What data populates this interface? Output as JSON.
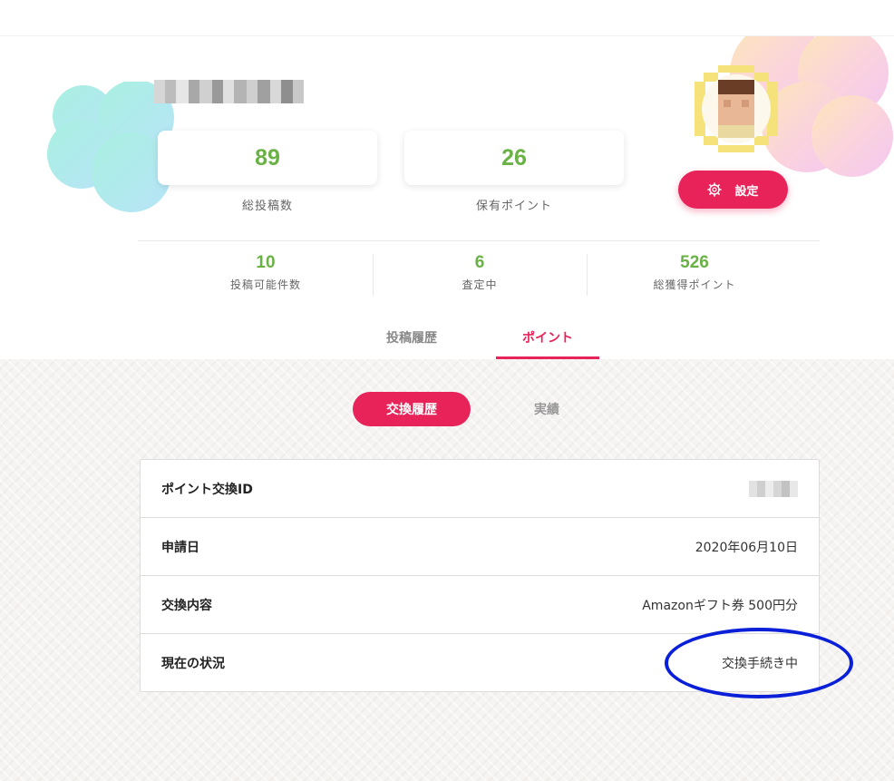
{
  "profile": {
    "stats": [
      {
        "value": "89",
        "label": "総投稿数"
      },
      {
        "value": "26",
        "label": "保有ポイント"
      }
    ],
    "mini_stats": [
      {
        "value": "10",
        "label": "投稿可能件数"
      },
      {
        "value": "6",
        "label": "査定中"
      },
      {
        "value": "526",
        "label": "総獲得ポイント"
      }
    ],
    "settings_label": "設定"
  },
  "tabs": [
    {
      "label": "投稿履歴",
      "active": false
    },
    {
      "label": "ポイント",
      "active": true
    }
  ],
  "sub_tabs": [
    {
      "label": "交換履歴",
      "active": true
    },
    {
      "label": "実績",
      "active": false
    }
  ],
  "exchange_table": {
    "rows": [
      {
        "label": "ポイント交換ID",
        "value": ""
      },
      {
        "label": "申請日",
        "value": "2020年06月10日"
      },
      {
        "label": "交換内容",
        "value": "Amazonギフト券 500円分"
      },
      {
        "label": "現在の状況",
        "value": "交換手続き中"
      }
    ]
  },
  "colors": {
    "accent": "#e8235a",
    "stat_green": "#6ab245",
    "annotation_blue": "#0a1fd8"
  },
  "icons": {
    "settings": "gear-icon"
  }
}
